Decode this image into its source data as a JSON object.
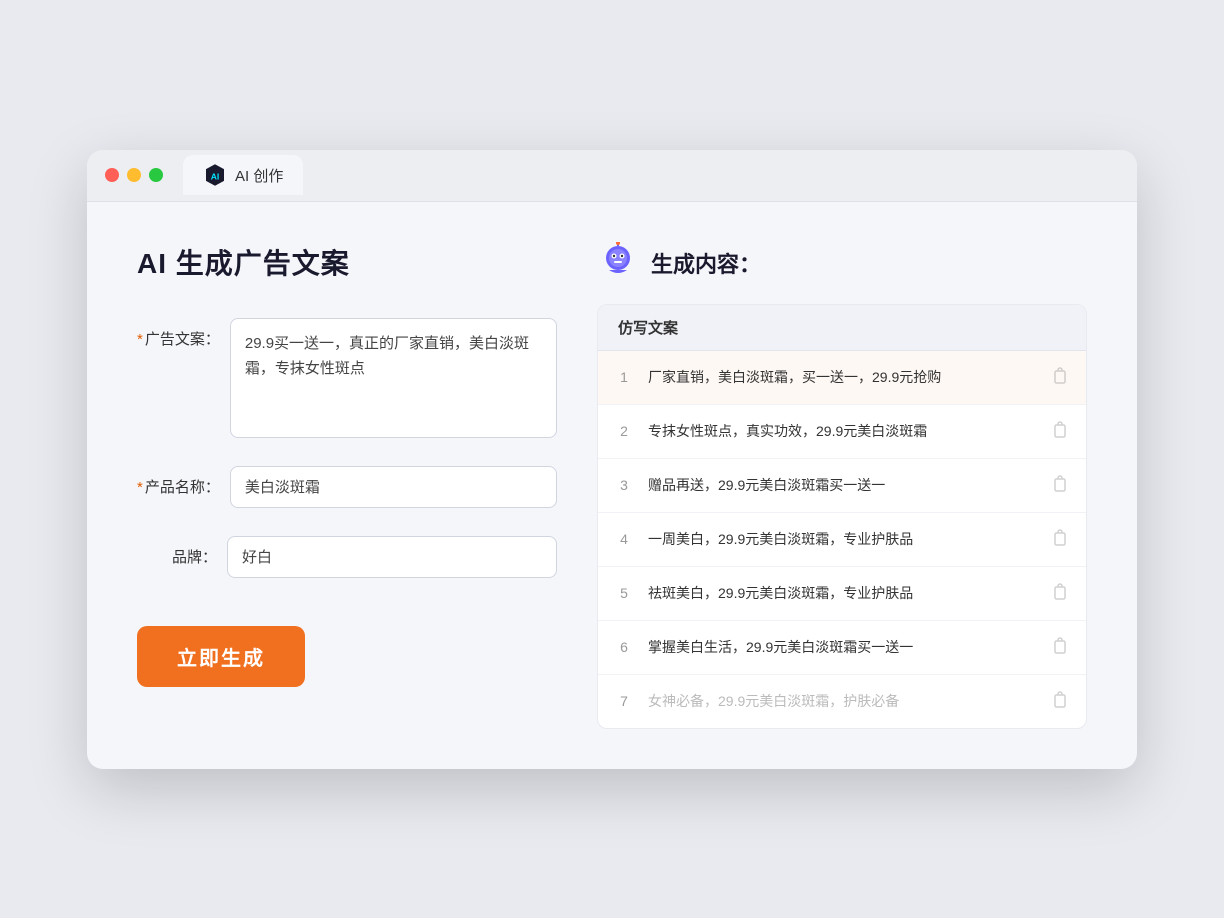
{
  "browser": {
    "tab_label": "AI 创作"
  },
  "page": {
    "title": "AI 生成广告文案"
  },
  "form": {
    "ad_copy_label": "广告文案：",
    "ad_copy_required": "*",
    "ad_copy_value": "29.9买一送一，真正的厂家直销，美白淡斑霜，专抹女性斑点",
    "product_name_label": "产品名称：",
    "product_name_required": "*",
    "product_name_value": "美白淡斑霜",
    "brand_label": "品牌：",
    "brand_value": "好白",
    "generate_button": "立即生成"
  },
  "result": {
    "title": "生成内容：",
    "column_header": "仿写文案",
    "items": [
      {
        "num": "1",
        "text": "厂家直销，美白淡斑霜，买一送一，29.9元抢购",
        "muted": false
      },
      {
        "num": "2",
        "text": "专抹女性斑点，真实功效，29.9元美白淡斑霜",
        "muted": false
      },
      {
        "num": "3",
        "text": "赠品再送，29.9元美白淡斑霜买一送一",
        "muted": false
      },
      {
        "num": "4",
        "text": "一周美白，29.9元美白淡斑霜，专业护肤品",
        "muted": false
      },
      {
        "num": "5",
        "text": "祛斑美白，29.9元美白淡斑霜，专业护肤品",
        "muted": false
      },
      {
        "num": "6",
        "text": "掌握美白生活，29.9元美白淡斑霜买一送一",
        "muted": false
      },
      {
        "num": "7",
        "text": "女神必备，29.9元美白淡斑霜，护肤必备",
        "muted": true
      }
    ]
  }
}
